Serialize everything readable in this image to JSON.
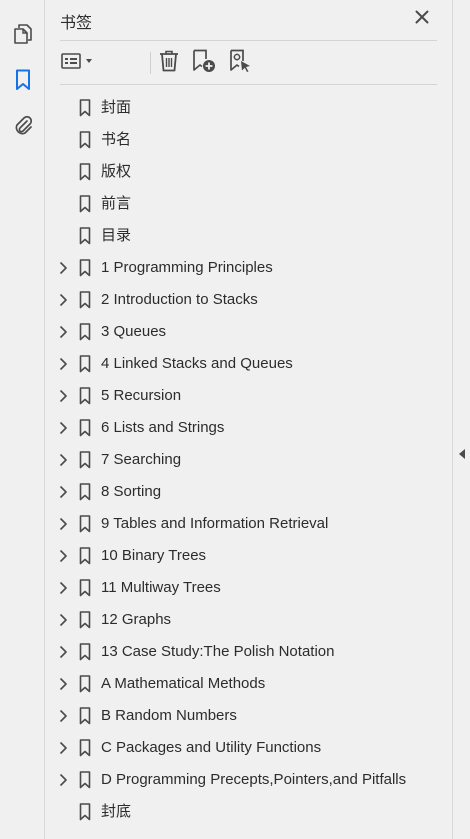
{
  "panel": {
    "title": "书签"
  },
  "icons": {
    "rail": [
      "pages-icon",
      "bookmark-panel-icon",
      "attachment-icon"
    ],
    "toolbar": [
      "options-menu-icon",
      "delete-bookmark-icon",
      "new-bookmark-icon",
      "bookmark-from-selection-icon"
    ]
  },
  "colors": {
    "accent": "#1473e6",
    "icon": "#4b4b4b",
    "background": "#f0f0f0"
  },
  "bookmarks": [
    {
      "label": "封面",
      "expandable": false
    },
    {
      "label": "书名",
      "expandable": false
    },
    {
      "label": "版权",
      "expandable": false
    },
    {
      "label": "前言",
      "expandable": false
    },
    {
      "label": "目录",
      "expandable": false
    },
    {
      "label": "1 Programming Principles",
      "expandable": true
    },
    {
      "label": "2 Introduction to Stacks",
      "expandable": true
    },
    {
      "label": "3 Queues",
      "expandable": true
    },
    {
      "label": "4 Linked Stacks and Queues",
      "expandable": true
    },
    {
      "label": "5 Recursion",
      "expandable": true
    },
    {
      "label": "6 Lists and Strings",
      "expandable": true
    },
    {
      "label": "7 Searching",
      "expandable": true
    },
    {
      "label": "8 Sorting",
      "expandable": true
    },
    {
      "label": "9 Tables and Information Retrieval",
      "expandable": true
    },
    {
      "label": "10 Binary Trees",
      "expandable": true
    },
    {
      "label": "11 Multiway Trees",
      "expandable": true
    },
    {
      "label": "12 Graphs",
      "expandable": true
    },
    {
      "label": "13 Case Study:The Polish Notation",
      "expandable": true
    },
    {
      "label": "A Mathematical Methods",
      "expandable": true
    },
    {
      "label": "B Random Numbers",
      "expandable": true
    },
    {
      "label": "C Packages and Utility Functions",
      "expandable": true
    },
    {
      "label": "D Programming Precepts,Pointers,and Pitfalls",
      "expandable": true
    },
    {
      "label": "封底",
      "expandable": false
    }
  ]
}
